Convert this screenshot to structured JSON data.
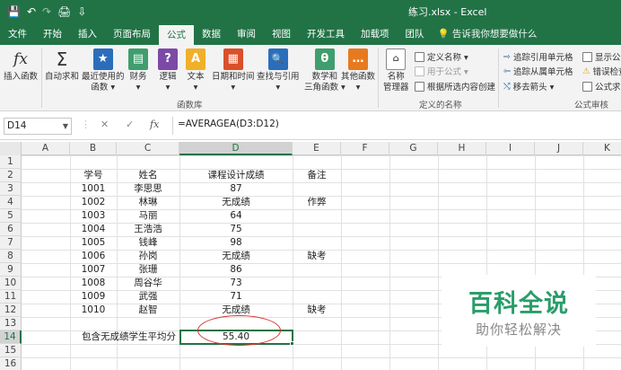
{
  "titlebar": {
    "title": "练习.xlsx  -  Excel",
    "qat": [
      "💾",
      "↶",
      "↷",
      "🖨",
      "⇩"
    ]
  },
  "tabs": [
    "文件",
    "开始",
    "插入",
    "页面布局",
    "公式",
    "数据",
    "审阅",
    "视图",
    "开发工具",
    "加载项",
    "团队",
    "告诉我你想要做什么"
  ],
  "active_tab": "公式",
  "ribbon": {
    "insert_function": {
      "icon": "fx",
      "label": "插入函数"
    },
    "autosum": {
      "icon": "Σ",
      "label1": "自动求和",
      "label2": ""
    },
    "recent": {
      "icon": "★",
      "label1": "最近使用的",
      "label2": "函数 ▾"
    },
    "finance": {
      "icon": "▤",
      "label1": "财务",
      "label2": "▾"
    },
    "logic": {
      "icon": "?",
      "label1": "逻辑",
      "label2": "▾"
    },
    "text": {
      "icon": "A",
      "label1": "文本",
      "label2": "▾"
    },
    "datetime": {
      "icon": "▦",
      "label1": "日期和时间",
      "label2": "▾"
    },
    "lookup": {
      "icon": "🔍",
      "label1": "查找与引用",
      "label2": "▾"
    },
    "math": {
      "icon": "θ",
      "label1": "数学和",
      "label2": "三角函数 ▾"
    },
    "other": {
      "icon": "…",
      "label1": "其他函数",
      "label2": "▾"
    },
    "library_group": "函数库",
    "name_manager": {
      "label1": "名称",
      "label2": "管理器"
    },
    "define_name": "定义名称 ▾",
    "use_in_formula": "用于公式 ▾",
    "create_from_selection": "根据所选内容创建",
    "names_group": "定义的名称",
    "trace_precedents": "追踪引用单元格",
    "trace_dependents": "追踪从属单元格",
    "remove_arrows": "移去箭头 ▾",
    "show_formulas": "显示公式",
    "error_check": "错误检查",
    "evaluate": "公式求值",
    "audit_group": "公式审核"
  },
  "formula_bar": {
    "name_box": "D14",
    "cancel": "✕",
    "enter": "✓",
    "fx": "fx",
    "formula": "=AVERAGEA(D3:D12)"
  },
  "columns": [
    "A",
    "B",
    "C",
    "D",
    "E",
    "F",
    "G",
    "H",
    "I",
    "J",
    "K"
  ],
  "rows": [
    "1",
    "2",
    "3",
    "4",
    "5",
    "6",
    "7",
    "8",
    "9",
    "10",
    "11",
    "12",
    "13",
    "14",
    "15",
    "16"
  ],
  "sheet": {
    "header": {
      "id": "学号",
      "name": "姓名",
      "score": "课程设计成绩",
      "note": "备注"
    },
    "records": [
      {
        "id": "1001",
        "name": "李思思",
        "score": "87",
        "note": ""
      },
      {
        "id": "1002",
        "name": "林琳",
        "score": "无成绩",
        "note": "作弊"
      },
      {
        "id": "1003",
        "name": "马丽",
        "score": "64",
        "note": ""
      },
      {
        "id": "1004",
        "name": "王浩浩",
        "score": "75",
        "note": ""
      },
      {
        "id": "1005",
        "name": "钱峰",
        "score": "98",
        "note": ""
      },
      {
        "id": "1006",
        "name": "孙岗",
        "score": "无成绩",
        "note": "缺考"
      },
      {
        "id": "1007",
        "name": "张珊",
        "score": "86",
        "note": ""
      },
      {
        "id": "1008",
        "name": "周谷华",
        "score": "73",
        "note": ""
      },
      {
        "id": "1009",
        "name": "武强",
        "score": "71",
        "note": ""
      },
      {
        "id": "1010",
        "name": "赵智",
        "score": "无成绩",
        "note": "缺考"
      }
    ],
    "avg_label": "包含无成绩学生平均分",
    "avg_value": "55.40"
  },
  "watermark": {
    "title": "百科全说",
    "subtitle": "助你轻松解决"
  },
  "colors": {
    "excel_green": "#217346",
    "annotation_red": "#d9342b",
    "watermark_green": "#2a9d6a"
  }
}
